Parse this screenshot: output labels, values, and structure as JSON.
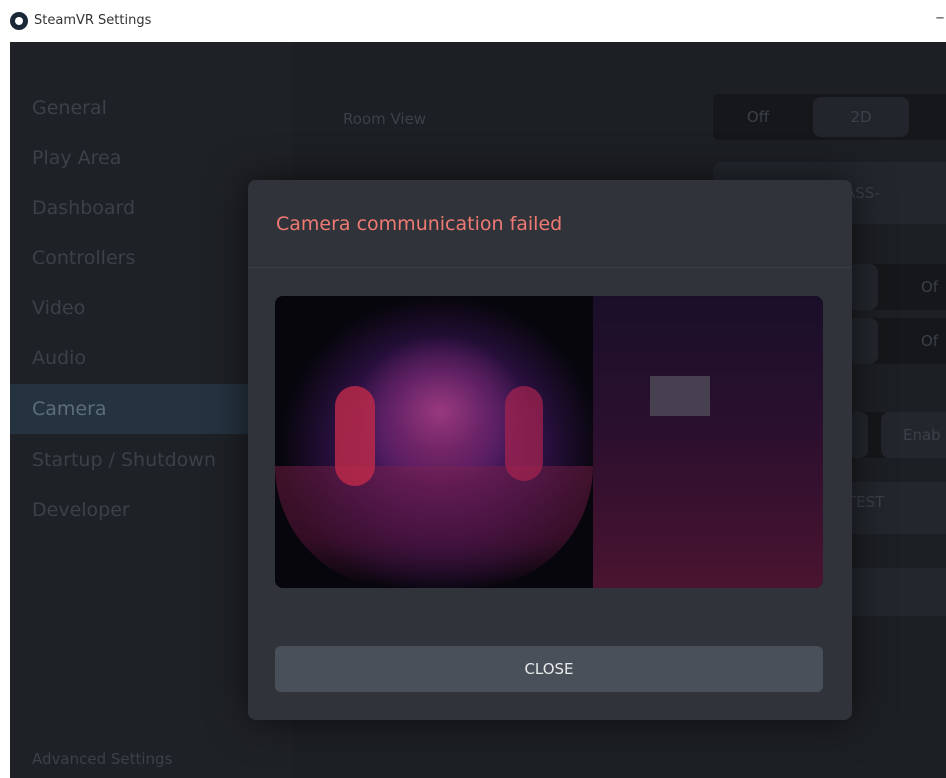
{
  "window": {
    "title": "SteamVR Settings",
    "minimize_glyph": "–"
  },
  "sidebar": {
    "items": [
      {
        "label": "General"
      },
      {
        "label": "Play Area"
      },
      {
        "label": "Dashboard"
      },
      {
        "label": "Controllers"
      },
      {
        "label": "Video"
      },
      {
        "label": "Audio"
      },
      {
        "label": "Camera"
      },
      {
        "label": "Startup / Shutdown"
      },
      {
        "label": "Developer"
      }
    ],
    "active": "Camera",
    "advanced_settings": "Advanced Settings"
  },
  "main": {
    "room_view_label": "Room View",
    "room_view_options": [
      "Off",
      "2D"
    ],
    "room_view_selected": "2D",
    "button_fragments": [
      "T PASS-",
      "Of",
      "Of",
      "Enab",
      "T TEST"
    ]
  },
  "modal": {
    "title": "Camera communication failed",
    "close_label": "CLOSE"
  },
  "colors": {
    "background": "#1c1f24",
    "modal": "#30343a",
    "error_text": "#f07a73",
    "active_sidebar": "#25323f",
    "button": "#4a5059"
  },
  "icons": {
    "app_logo": "steamvr-logo-icon",
    "minimize": "minimize-icon"
  }
}
